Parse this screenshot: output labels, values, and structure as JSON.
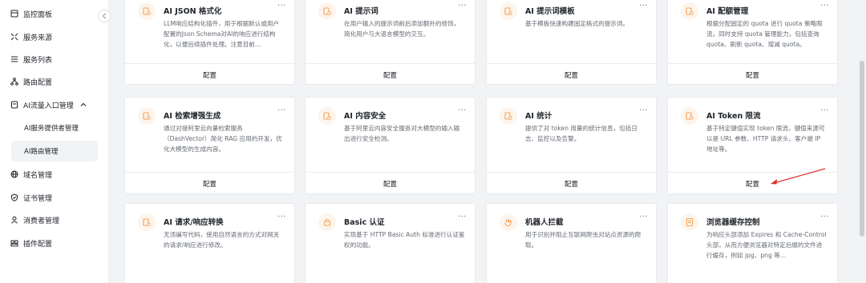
{
  "sidebar": {
    "items": [
      {
        "label": "监控面板",
        "icon": "dashboard-icon"
      },
      {
        "label": "服务来源",
        "icon": "source-icon"
      },
      {
        "label": "服务列表",
        "icon": "list-icon"
      },
      {
        "label": "路由配置",
        "icon": "route-icon"
      },
      {
        "label": "AI流量入口管理",
        "icon": "ai-gateway-icon"
      },
      {
        "label": "AI服务提供者管理",
        "icon": ""
      },
      {
        "label": "AI路由管理",
        "icon": ""
      },
      {
        "label": "域名管理",
        "icon": "globe-icon"
      },
      {
        "label": "证书管理",
        "icon": "shield-icon"
      },
      {
        "label": "消费者管理",
        "icon": "user-icon"
      },
      {
        "label": "插件配置",
        "icon": "plugin-icon"
      }
    ]
  },
  "cards": [
    {
      "title": "AI JSON 格式化",
      "desc": "LLM响应结构化插件，用于根据默认或用户配置的Json Schema对AI的响应进行结构化，以便后续插件处理。注意目前…",
      "action": "配置"
    },
    {
      "title": "AI 提示词",
      "desc": "在用户输入的提示词前后添加额外的修饰，简化用户与大语言模型的交互。",
      "action": "配置"
    },
    {
      "title": "AI 提示词模板",
      "desc": "基于模板快速构建固定格式的提示词。",
      "action": "配置"
    },
    {
      "title": "AI 配额管理",
      "desc": "根据分配固定的 quota 进行 quota 策略限流，同时支持 quota 管理能力，包括查询 quota、刷新 quota、增减 quota。",
      "action": "配置"
    },
    {
      "title": "AI 检索增强生成",
      "desc": "通过对接阿里云向量检索服务（DashVector）简化 RAG 应用的开发，优化大模型的生成内容。",
      "action": "配置"
    },
    {
      "title": "AI 内容安全",
      "desc": "基于阿里云内容安全服务对大模型的输入输出进行安全检测。",
      "action": "配置"
    },
    {
      "title": "AI 统计",
      "desc": "提供了对 token 用量的统计信息，包括日志、监控以及告警。",
      "action": "配置"
    },
    {
      "title": "AI Token 限流",
      "desc": "基于特定键值实现 token 限流，键值来源可以是 URL 参数、HTTP 请求头、客户端 IP 地址等。",
      "action": "配置"
    },
    {
      "title": "AI 请求/响应转换",
      "desc": "无须编写代码，使用自然语言的方式对网关的请求/响应进行修改。",
      "action": ""
    },
    {
      "title": "Basic 认证",
      "desc": "实现基于 HTTP Basic Auth 标准进行认证鉴权的功能。",
      "action": ""
    },
    {
      "title": "机器人拦截",
      "desc": "用于识别并阻止互联网爬虫对站点资源的爬取。",
      "action": ""
    },
    {
      "title": "浏览器缓存控制",
      "desc": "为响应头部添加 Expires 和 Cache-Control 头部，从而方便浏览器对特定后缀的文件进行缓存，例如 jpg、png 等…",
      "action": ""
    }
  ],
  "more_label": "···",
  "colors": {
    "accent": "#f5a25d",
    "annotation_arrow": "#e0312a"
  }
}
